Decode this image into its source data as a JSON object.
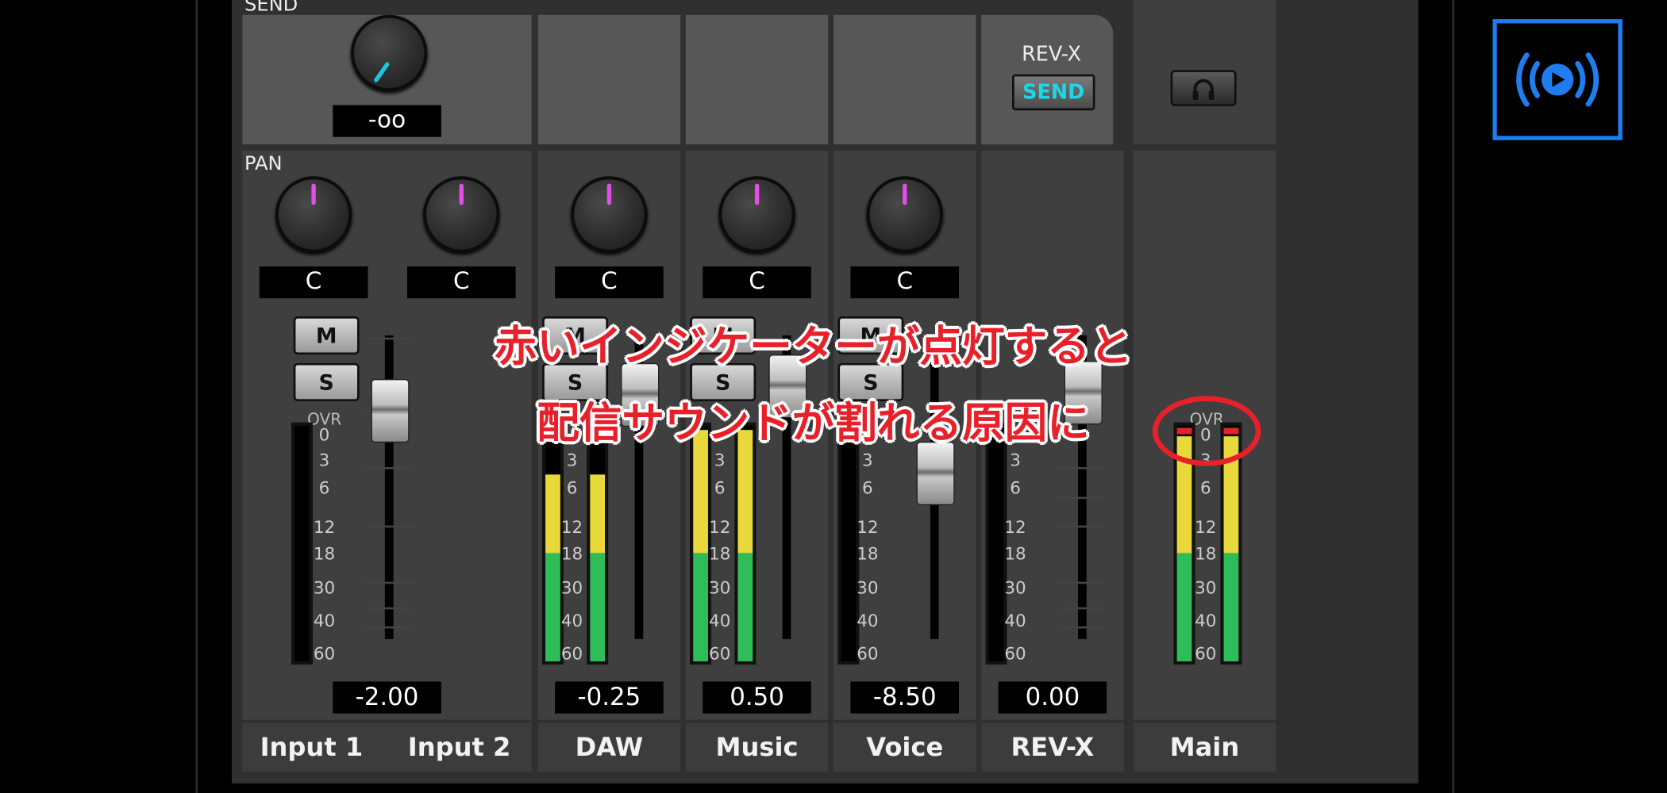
{
  "send_label": "SEND",
  "send_value": "-oo",
  "pan_label": "PAN",
  "revx": {
    "title": "REV-X",
    "send_button": "SEND"
  },
  "headphone_icon": "headphones-icon",
  "stream_icon": "live-stream-icon",
  "mute_label": "M",
  "solo_label": "S",
  "ovr_label": "OVR",
  "meter_scale": [
    "0",
    "3",
    "6",
    "12",
    "18",
    "30",
    "40",
    "60"
  ],
  "pan_values": [
    "C",
    "C",
    "C",
    "C",
    "C"
  ],
  "gains": [
    "-2.00",
    "-0.25",
    "0.50",
    "-8.50",
    "0.00"
  ],
  "channels": [
    "Input 1",
    "Input 2",
    "DAW",
    "Music",
    "Voice",
    "REV-X",
    "Main"
  ],
  "annotation": {
    "line1": "赤いインジケーターが点灯すると",
    "line2": "配信サウンドが割れる原因に"
  },
  "colors": {
    "pan_indicator": "#e44ee8",
    "send_indicator": "#19c8dc",
    "meter_green": "#2fbd5a",
    "meter_yellow": "#e8d83a",
    "overload_red": "#e8202a",
    "highlight_blue": "#1f7df0"
  }
}
